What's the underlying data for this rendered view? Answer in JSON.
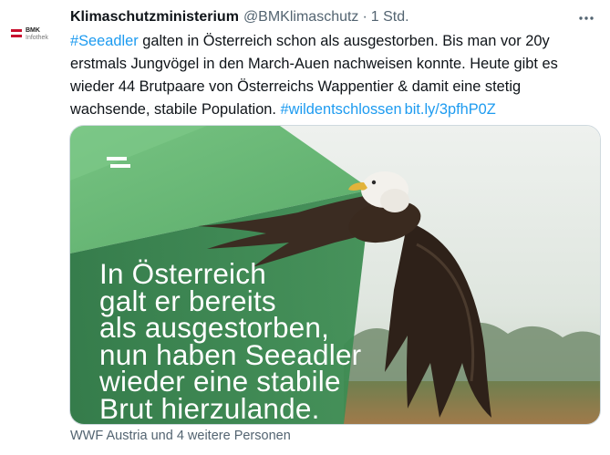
{
  "account": {
    "name": "Klimaschutzministerium",
    "handle": "@BMKlimaschutz",
    "separator": "·",
    "time": "1 Std.",
    "avatar": {
      "line1": "BMK",
      "line2": "Infothek",
      "flag_colors": [
        "#c8102e",
        "#ffffff",
        "#c8102e"
      ]
    }
  },
  "tweet": {
    "hashtag1": "#Seeadler",
    "text1": " galten in Österreich schon als ausgestorben. Bis man vor 20y erstmals Jungvögel in den March-Auen nachweisen konnte. Heute gibt es wieder 44 Brutpaare von Österreichs Wappentier & damit eine stetig wachsende, stabile Population. ",
    "hashtag2": "#wildentschlossen",
    "link": "bit.ly/3pfhP0Z"
  },
  "media": {
    "lines": [
      "In Österreich",
      "galt er bereits",
      "als ausgestorben,",
      "nun haben Seeadler",
      "wieder eine stabile",
      "Brut hierzulande."
    ],
    "colors": {
      "green_dark": "#2f7a45",
      "green_light": "#5fb56f",
      "sky": "#e9eee9",
      "text": "#ffffff"
    }
  },
  "footer": {
    "likes_text": "WWF Austria und 4 weitere Personen"
  },
  "icons": {
    "more": "more-dots-icon"
  }
}
